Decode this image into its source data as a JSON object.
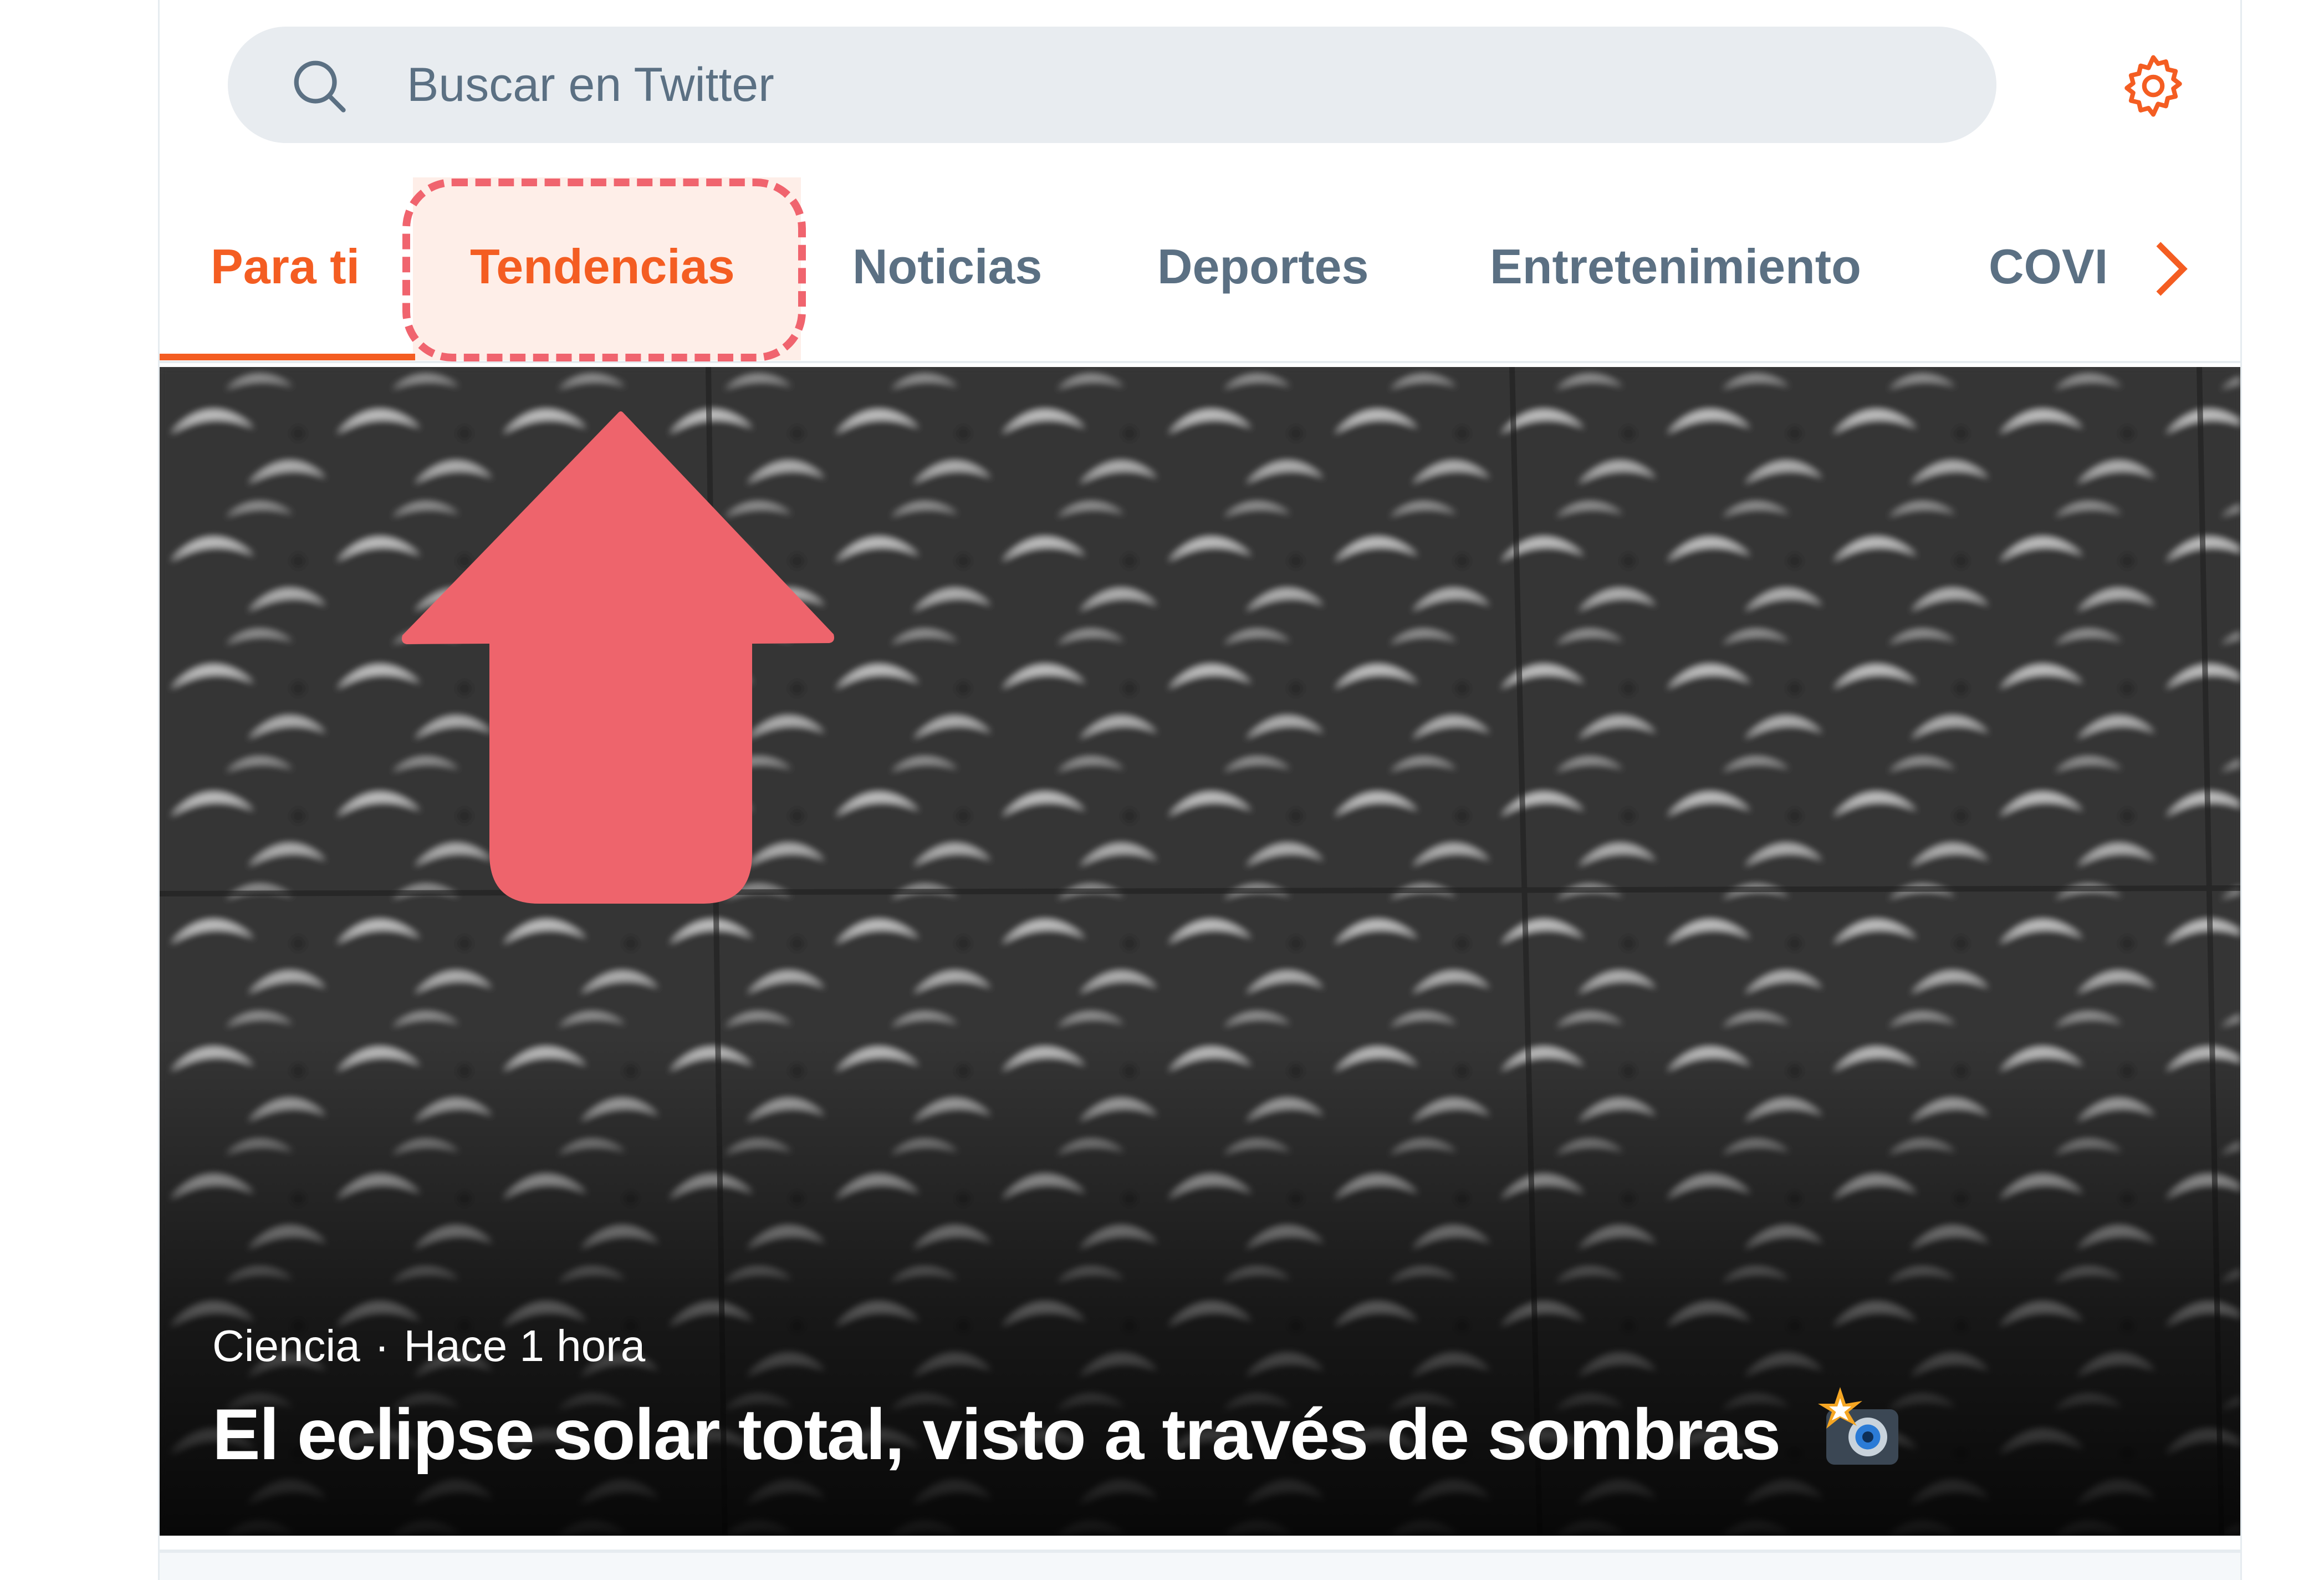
{
  "search": {
    "placeholder": "Buscar en Twitter",
    "icon": "search-icon"
  },
  "settings": {
    "icon": "gear-icon"
  },
  "tabs": [
    {
      "label": "Para ti",
      "active": true
    },
    {
      "label": "Tendencias",
      "active": false,
      "highlighted": true
    },
    {
      "label": "Noticias",
      "active": false
    },
    {
      "label": "Deportes",
      "active": false
    },
    {
      "label": "Entretenimiento",
      "active": false
    },
    {
      "label": "COVI",
      "active": false
    }
  ],
  "tabs_scroll": {
    "icon": "chevron-right-icon"
  },
  "hero": {
    "category": "Ciencia",
    "separator": "·",
    "time": "Hace 1 hora",
    "headline": "El eclipse solar total, visto a través de sombras",
    "emoji": "camera-with-flash-emoji"
  },
  "annotation": {
    "type": "up-arrow",
    "target": "Tendencias",
    "color": "#f0646e"
  },
  "colors": {
    "accent": "#f45d22",
    "tab_inactive": "#5b7083",
    "search_bg": "#e8ecf0",
    "annotation": "#f0646e"
  }
}
